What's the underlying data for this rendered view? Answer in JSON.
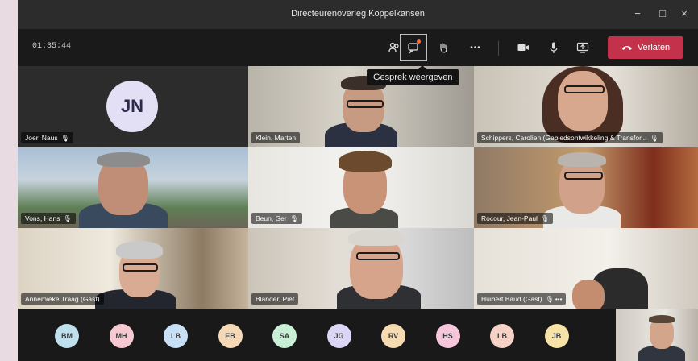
{
  "window": {
    "title": "Directeurenoverleg Koppelkansen",
    "minimize": "−",
    "maximize": "□",
    "close": "×"
  },
  "toolbar": {
    "timer": "01:35:44",
    "more": "•••",
    "leave_label": "Verlaten",
    "tooltip": "Gesprek weergeven"
  },
  "participants": [
    {
      "name": "Joeri Naus",
      "initials": "JN",
      "mic": "🎙"
    },
    {
      "name": "Klein, Marten",
      "mic": ""
    },
    {
      "name": "Schippers, Carolien (Gebiedsontwikkeling & Transfor...",
      "mic": "🎙"
    },
    {
      "name": "Vons, Hans",
      "mic": "🎙"
    },
    {
      "name": "Beun, Ger",
      "mic": "🎙"
    },
    {
      "name": "Rocour, Jean-Paul",
      "mic": "🎙"
    },
    {
      "name": "Annemieke Traag (Gast)",
      "mic": ""
    },
    {
      "name": "Blander, Piet",
      "mic": ""
    },
    {
      "name": "Huibert Baud (Gast)",
      "mic": "🎙 •••"
    }
  ],
  "attendees": [
    {
      "initials": "BM",
      "color": "#bfe1ee"
    },
    {
      "initials": "MH",
      "color": "#f6c9d2"
    },
    {
      "initials": "LB",
      "color": "#c7e0f5"
    },
    {
      "initials": "EB",
      "color": "#f5d9b6"
    },
    {
      "initials": "SA",
      "color": "#c9efd6"
    },
    {
      "initials": "JG",
      "color": "#dcd6f6"
    },
    {
      "initials": "RV",
      "color": "#f7dbb0"
    },
    {
      "initials": "HS",
      "color": "#f6c7da"
    },
    {
      "initials": "LB",
      "color": "#f5d1c6"
    },
    {
      "initials": "JB",
      "color": "#f7e3a8"
    }
  ]
}
